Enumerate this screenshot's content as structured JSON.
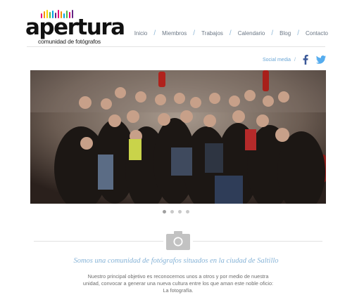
{
  "brand": {
    "name": "apertura",
    "subtitle": "comunidad de fotógrafos",
    "bar_colors": [
      "#e2007a",
      "#f39200",
      "#ffd500",
      "#52b848",
      "#00a0e3",
      "#662483",
      "#e2007a",
      "#f39200",
      "#00a0e3",
      "#52b848",
      "#e2007a",
      "#662483"
    ]
  },
  "nav": {
    "items": [
      "Inicio",
      "Miembros",
      "Trabajos",
      "Calendario",
      "Blog",
      "Contacto"
    ],
    "separator": "/"
  },
  "social": {
    "label": "Social media",
    "separator": "/",
    "icons": [
      "facebook-icon",
      "twitter-icon"
    ],
    "facebook_color": "#3b5998",
    "twitter_color": "#55acee"
  },
  "hero": {
    "image": "group-photo",
    "slides": 4,
    "active_slide": 1
  },
  "intro": {
    "icon": "camera-icon",
    "tagline": "Somos una comunidad de fotógrafos situados en la ciudad de Saltillo",
    "lines": [
      "Nuestro principal objetivo es reconocernos unos a otros y por medio de nuestra",
      "unidad, convocar a generar una nueva cultura entre los que aman este noble oficio:",
      "La fotografía."
    ]
  }
}
